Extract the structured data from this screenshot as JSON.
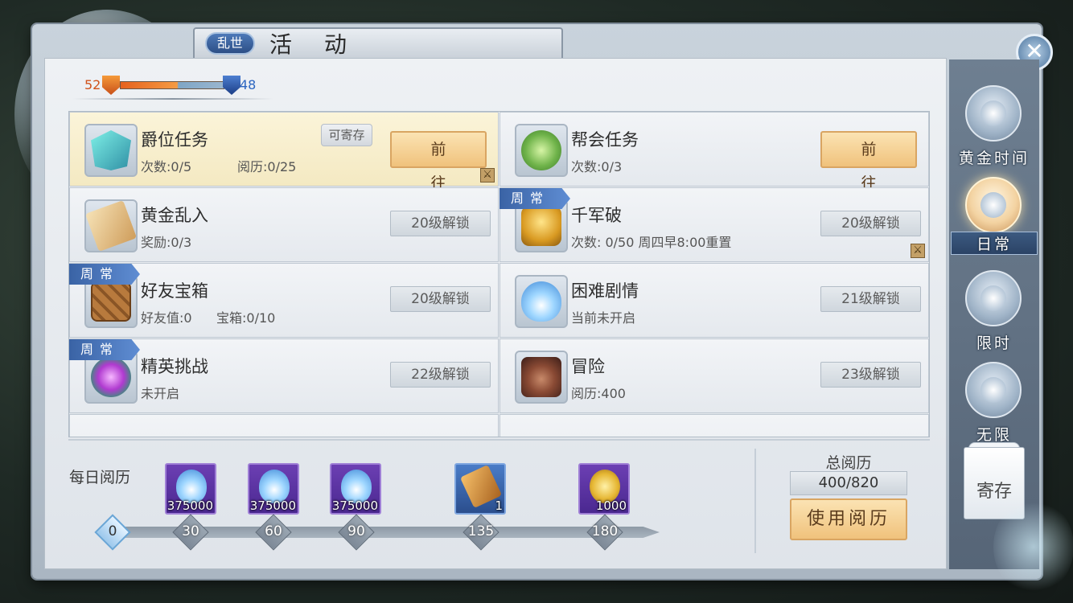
{
  "header": {
    "tag": "乱世",
    "title": "活动",
    "close_icon": "close-x-icon"
  },
  "faction": {
    "left_value": "52",
    "right_value": "48",
    "left_color": "#e6621e",
    "right_color": "#2d66c1"
  },
  "activities": [
    {
      "name": "爵位任务",
      "line1": "次数:0/5",
      "line2": "阅历:0/25",
      "tag": "可寄存",
      "action": "前往",
      "action_type": "go",
      "icon": "crystal-shield-icon",
      "selected": true
    },
    {
      "name": "帮会任务",
      "line1": "次数:0/3",
      "action": "前往",
      "action_type": "go",
      "icon": "jade-disc-icon"
    },
    {
      "name": "黄金乱入",
      "line1": "奖励:0/3",
      "action": "20级解锁",
      "action_type": "locked",
      "icon": "scroll-icon"
    },
    {
      "name": "千军破",
      "line1": "次数: 0/50 周四早8:00重置",
      "week_tag": "周常",
      "action": "20级解锁",
      "action_type": "locked",
      "icon": "golden-beast-icon"
    },
    {
      "name": "好友宝箱",
      "line1": "好友值:0",
      "line2": "宝箱:0/10",
      "week_tag": "周常",
      "action": "20级解锁",
      "action_type": "locked",
      "icon": "wooden-crate-icon"
    },
    {
      "name": "困难剧情",
      "line1": "当前未开启",
      "action": "21级解锁",
      "action_type": "locked",
      "icon": "blue-flame-icon"
    },
    {
      "name": "精英挑战",
      "line1": "未开启",
      "week_tag": "周常",
      "action": "22级解锁",
      "action_type": "locked",
      "icon": "purple-eye-icon"
    },
    {
      "name": "冒险",
      "line1": "阅历:400",
      "action": "23级解锁",
      "action_type": "locked",
      "icon": "warrior-portrait-icon"
    }
  ],
  "daily": {
    "label": "每日阅历",
    "rewards": [
      {
        "qty": "375000",
        "icon": "blue-flame-icon",
        "style": "purple"
      },
      {
        "qty": "375000",
        "icon": "blue-flame-icon",
        "style": "purple"
      },
      {
        "qty": "375000",
        "icon": "blue-flame-icon",
        "style": "purple"
      },
      {
        "qty": "1",
        "icon": "scroll-icon",
        "style": "blue"
      },
      {
        "qty": "1000",
        "icon": "gold-coins-icon",
        "style": "purple"
      }
    ],
    "milestones": [
      "0",
      "30",
      "60",
      "90",
      "135",
      "180"
    ]
  },
  "total": {
    "label": "总阅历",
    "value": "400/820",
    "button": "使用阅历"
  },
  "side_tabs": [
    {
      "label": "黄金时间",
      "icon": "dragon-emblem-icon"
    },
    {
      "label": "日常",
      "icon": "dragon-emblem-icon",
      "active": true
    },
    {
      "label": "限时",
      "icon": "dragon-emblem-icon"
    },
    {
      "label": "无限",
      "icon": "dragon-emblem-icon"
    }
  ],
  "store_button": "寄存"
}
